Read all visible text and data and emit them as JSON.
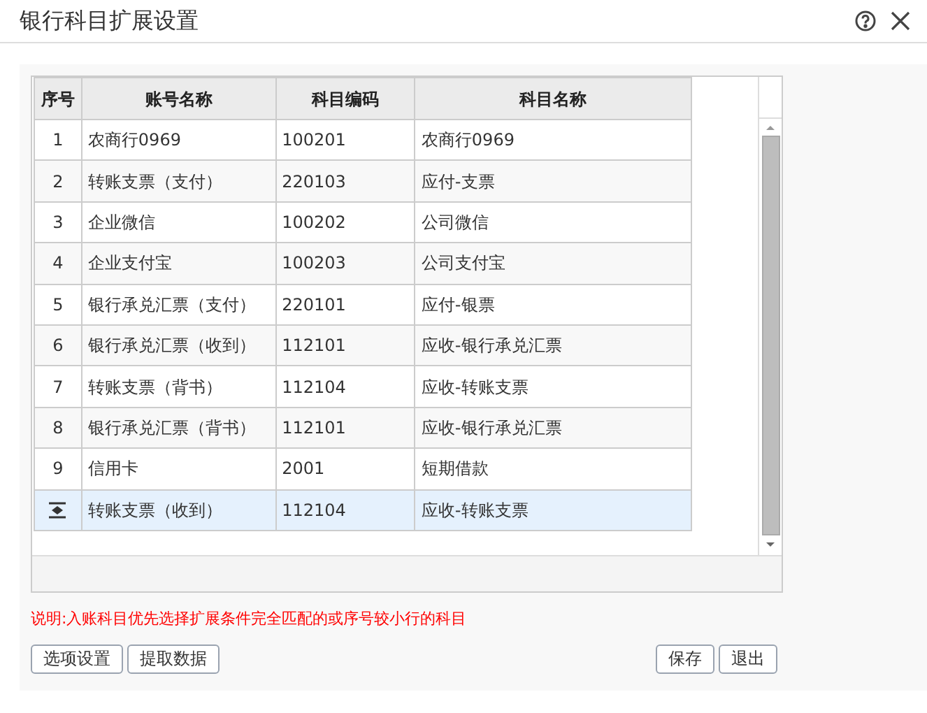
{
  "window": {
    "title": "银行科目扩展设置"
  },
  "table": {
    "columns": [
      "序号",
      "账号名称",
      "科目编码",
      "科目名称"
    ],
    "rows": [
      {
        "no": "1",
        "account": "农商行0969",
        "code": "100201",
        "subject": "农商行0969",
        "selected": false
      },
      {
        "no": "2",
        "account": "转账支票（支付）",
        "code": "220103",
        "subject": "应付-支票",
        "selected": false
      },
      {
        "no": "3",
        "account": "企业微信",
        "code": "100202",
        "subject": "公司微信",
        "selected": false
      },
      {
        "no": "4",
        "account": "企业支付宝",
        "code": "100203",
        "subject": "公司支付宝",
        "selected": false
      },
      {
        "no": "5",
        "account": "银行承兑汇票（支付）",
        "code": "220101",
        "subject": "应付-银票",
        "selected": false
      },
      {
        "no": "6",
        "account": "银行承兑汇票（收到）",
        "code": "112101",
        "subject": "应收-银行承兑汇票",
        "selected": false
      },
      {
        "no": "7",
        "account": "转账支票（背书）",
        "code": "112104",
        "subject": "应收-转账支票",
        "selected": false
      },
      {
        "no": "8",
        "account": "银行承兑汇票（背书）",
        "code": "112101",
        "subject": "应收-银行承兑汇票",
        "selected": false
      },
      {
        "no": "9",
        "account": "信用卡",
        "code": "2001",
        "subject": "短期借款",
        "selected": false
      },
      {
        "account": "转账支票（收到）",
        "code": "112104",
        "subject": "应收-转账支票",
        "selected": true
      }
    ]
  },
  "note": "说明:入账科目优先选择扩展条件完全匹配的或序号较小行的科目",
  "left_buttons": [
    "选项设置",
    "提取数据"
  ],
  "right_buttons": [
    "保存",
    "退出"
  ]
}
